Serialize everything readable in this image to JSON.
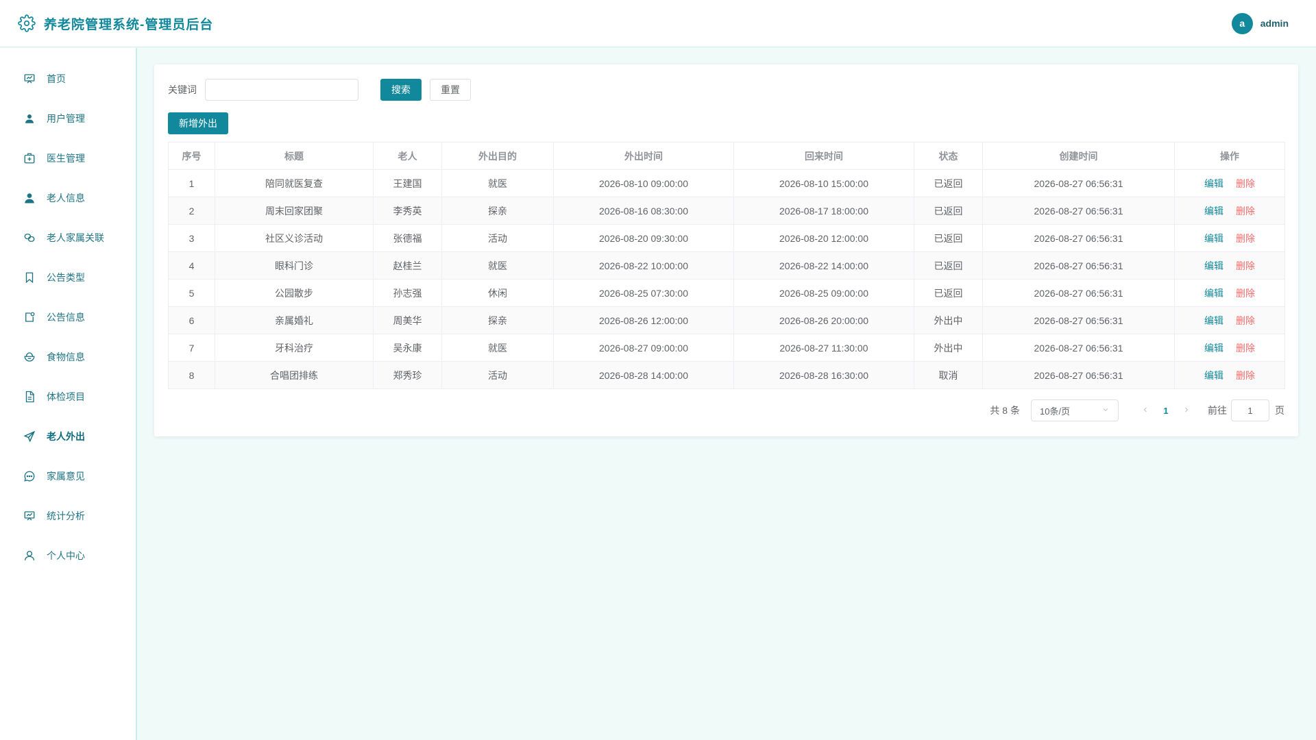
{
  "header": {
    "title": "养老院管理系统-管理员后台",
    "avatar_letter": "a",
    "username": "admin"
  },
  "sidebar": {
    "items": [
      {
        "label": "首页",
        "icon": "dashboard-icon"
      },
      {
        "label": "用户管理",
        "icon": "user-icon"
      },
      {
        "label": "医生管理",
        "icon": "medical-kit-icon"
      },
      {
        "label": "老人信息",
        "icon": "person-icon"
      },
      {
        "label": "老人家属关联",
        "icon": "link-icon"
      },
      {
        "label": "公告类型",
        "icon": "bookmark-icon"
      },
      {
        "label": "公告信息",
        "icon": "notice-icon"
      },
      {
        "label": "食物信息",
        "icon": "food-icon"
      },
      {
        "label": "体检项目",
        "icon": "document-icon"
      },
      {
        "label": "老人外出",
        "icon": "send-icon",
        "active": true
      },
      {
        "label": "家属意见",
        "icon": "chat-icon"
      },
      {
        "label": "统计分析",
        "icon": "chart-icon"
      },
      {
        "label": "个人中心",
        "icon": "profile-icon"
      }
    ]
  },
  "search": {
    "label": "关键词",
    "value": "",
    "placeholder": "",
    "search_button": "搜索",
    "reset_button": "重置"
  },
  "toolbar": {
    "add_button": "新增外出"
  },
  "table": {
    "columns": [
      "序号",
      "标题",
      "老人",
      "外出目的",
      "外出时间",
      "回来时间",
      "状态",
      "创建时间",
      "操作"
    ],
    "action_edit": "编辑",
    "action_delete": "删除",
    "rows": [
      {
        "no": "1",
        "title": "陪同就医复查",
        "elder": "王建国",
        "purpose": "就医",
        "out_time": "2026-08-10 09:00:00",
        "back_time": "2026-08-10 15:00:00",
        "status": "已返回",
        "created": "2026-08-27 06:56:31"
      },
      {
        "no": "2",
        "title": "周末回家团聚",
        "elder": "李秀英",
        "purpose": "探亲",
        "out_time": "2026-08-16 08:30:00",
        "back_time": "2026-08-17 18:00:00",
        "status": "已返回",
        "created": "2026-08-27 06:56:31"
      },
      {
        "no": "3",
        "title": "社区义诊活动",
        "elder": "张德福",
        "purpose": "活动",
        "out_time": "2026-08-20 09:30:00",
        "back_time": "2026-08-20 12:00:00",
        "status": "已返回",
        "created": "2026-08-27 06:56:31"
      },
      {
        "no": "4",
        "title": "眼科门诊",
        "elder": "赵桂兰",
        "purpose": "就医",
        "out_time": "2026-08-22 10:00:00",
        "back_time": "2026-08-22 14:00:00",
        "status": "已返回",
        "created": "2026-08-27 06:56:31"
      },
      {
        "no": "5",
        "title": "公园散步",
        "elder": "孙志强",
        "purpose": "休闲",
        "out_time": "2026-08-25 07:30:00",
        "back_time": "2026-08-25 09:00:00",
        "status": "已返回",
        "created": "2026-08-27 06:56:31"
      },
      {
        "no": "6",
        "title": "亲属婚礼",
        "elder": "周美华",
        "purpose": "探亲",
        "out_time": "2026-08-26 12:00:00",
        "back_time": "2026-08-26 20:00:00",
        "status": "外出中",
        "created": "2026-08-27 06:56:31"
      },
      {
        "no": "7",
        "title": "牙科治疗",
        "elder": "吴永康",
        "purpose": "就医",
        "out_time": "2026-08-27 09:00:00",
        "back_time": "2026-08-27 11:30:00",
        "status": "外出中",
        "created": "2026-08-27 06:56:31"
      },
      {
        "no": "8",
        "title": "合唱团排练",
        "elder": "郑秀珍",
        "purpose": "活动",
        "out_time": "2026-08-28 14:00:00",
        "back_time": "2026-08-28 16:30:00",
        "status": "取消",
        "created": "2026-08-27 06:56:31"
      }
    ]
  },
  "pagination": {
    "total_text": "共 8 条",
    "page_size": "10条/页",
    "prev_icon": "chevron-left-icon",
    "next_icon": "chevron-right-icon",
    "current_page": "1",
    "goto_label": "前往",
    "goto_value": "1",
    "goto_suffix": "页"
  },
  "colors": {
    "accent": "#12889c",
    "danger": "#f56c6c",
    "background": "#f0faf9"
  }
}
